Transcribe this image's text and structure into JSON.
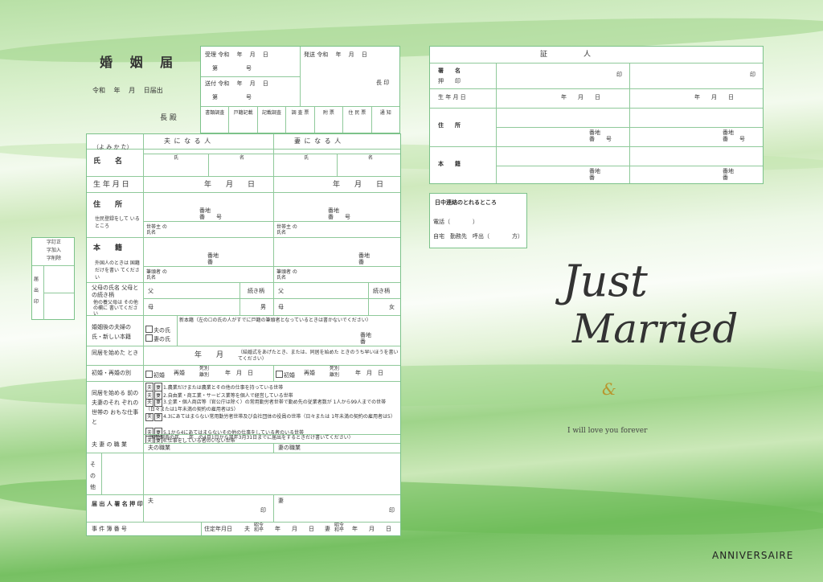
{
  "form": {
    "title": "婚 姻 届",
    "date_line": "令和　 年　 月　 日届出",
    "chief_suffix": "長 殿",
    "office": {
      "received": "受理 令和　 年　 月　 日",
      "received_no": "第　　　　　号",
      "sent": "送付 令和　 年　 月　 日",
      "sent_no": "第　　　　　号",
      "dispatch": "発送 令和　 年　 月　 日",
      "seal": "長 印",
      "columns": [
        "書類調査",
        "戸籍記載",
        "記載調査",
        "調 査 票",
        "附 票",
        "住 民 票",
        "通 知"
      ]
    },
    "rows": {
      "yomikata": "（よ み か た）",
      "husband_header": "夫 に な る 人",
      "wife_header": "妻 に な る 人",
      "surname": "氏",
      "given": "名",
      "name_label": "氏　　名",
      "birth_label": "生 年 月 日",
      "birth_value": "年　　月　　日",
      "address_label": "住　　所",
      "address_note": "住民登録をして いるところ",
      "banchi": "番地",
      "ban_go": "番　　号",
      "household_head": "世帯主 の氏名",
      "honseki_label": "本　　籍",
      "honseki_note": "外国人のときは 国籍だけを書い てください",
      "ban": "番",
      "fudeto": "筆頭者 の氏名",
      "parents_label": "父母の氏名 父母との続き柄",
      "parents_note": "他の養父母は その他の欄に 書いてください",
      "relation": "続き柄",
      "father": "父",
      "mother": "母",
      "son": "男",
      "daughter": "女",
      "after_marriage_label": "婚姻後の夫婦の 氏・新しい本籍",
      "husband_surname": "夫の氏",
      "wife_surname": "妻の氏",
      "new_honseki": "新本籍（左の☐の氏の人がすでに戸籍の筆頭者となっているときは書かないでください）",
      "cohabit_label": "同居を始めた とき",
      "cohabit_value": "年　　月",
      "cohabit_note": "（結婚式をあげたとき、または、同居を始めた ときのうち早いほうを書いてください）",
      "remarry_label": "初婚・再婚の別",
      "first_marriage": "初婚",
      "remarriage": "再婚",
      "death_sep": "死別",
      "divorce_sep": "離別",
      "ymd": "年　月　日",
      "work_label": "同居を始める 前の夫妻のそれ ぞれの世帯の おもな仕事と",
      "husband_tag": "夫",
      "wife_tag": "妻",
      "work_items": [
        "1.農業だけまたは農業とその他の仕事を持っている世帯",
        "2.自由業・商工業・サービス業等を個人で経営している世帯",
        "3.企業・個人商店等（官公庁は除く）の常用勤労者世帯で勤め先の従業者数が 1人から99人までの世帯（日々または1年未満の契約の雇用者は5）",
        "4.3にあてはまらない常用勤労者世帯及び会社団体の役員の世帯（日々または 1年未満の契約の雇用者は5）",
        "5.1から4にあてはまらないその他の仕事をしている者のいる世帯",
        "6.仕事をしている者のいない世帯"
      ],
      "census_note": "（国勢調査の年…　年…の4月1日から翌年3月31日までに届出をするときだけ書いてください）",
      "occupation_label": "夫 妻 の 職 業",
      "husband_occupation": "夫の職業",
      "wife_occupation": "妻の職業",
      "other_label": "そ の 他",
      "applicant_label": "届 出 人 署 名 押 印",
      "husband": "夫",
      "wife": "妻",
      "seal_mark": "印",
      "case_no_label": "事 件 簿 番 号",
      "move_date": "住定年月日",
      "move_value": "年　　月　　日",
      "showa_heisei": "昭令 和平",
      "stamp_label": "届 出 印",
      "correction": [
        "字訂正",
        "字加入",
        "字削除"
      ]
    }
  },
  "witness": {
    "title": "証　　　　　人",
    "sign_label": "署　　名",
    "seal_label": "押　　印",
    "birth_label": "生 年 月 日",
    "birth_value": "年　　月　　日",
    "address_label": "住　　所",
    "honseki_label": "本　　籍",
    "banchi": "番地",
    "ban_go": "番　　号",
    "ban": "番",
    "seal_mark": "印"
  },
  "contact": {
    "title": "日中連絡のとれるところ",
    "phone": "電話（　　　　）",
    "home_work": "自宅　勤務先　呼出（　　　　方）"
  },
  "decor": {
    "script_line1": "Just",
    "script_line2": "Married",
    "ampersand": "&",
    "tagline": "I will love you forever",
    "brand": "ANNIVERSAIRE"
  },
  "colors": {
    "line_green": "#8fc99a",
    "gold": "#b8962e"
  }
}
